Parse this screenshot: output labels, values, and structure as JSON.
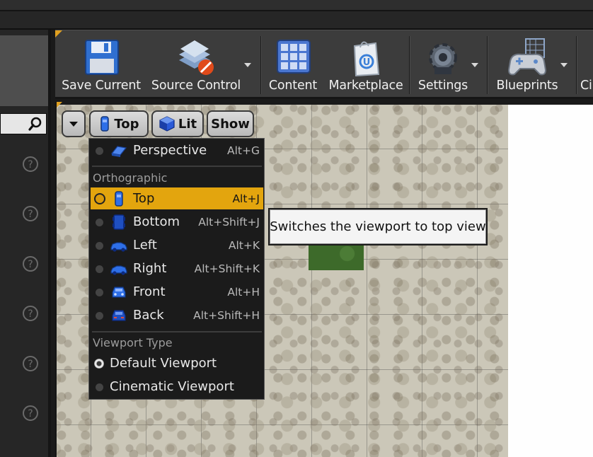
{
  "toolbar": {
    "buttons": [
      {
        "label": "Save Current",
        "icon": "floppy-disk-icon"
      },
      {
        "label": "Source Control",
        "icon": "source-control-icon"
      },
      {
        "label": "Content",
        "icon": "content-grid-icon"
      },
      {
        "label": "Marketplace",
        "icon": "marketplace-bag-icon"
      },
      {
        "label": "Settings",
        "icon": "gear-icon"
      },
      {
        "label": "Blueprints",
        "icon": "gamepad-icon"
      },
      {
        "label": "Ci",
        "icon": "cinematics-icon"
      }
    ]
  },
  "viewport_toolbar": {
    "view_mode": "Top",
    "lighting": "Lit",
    "show": "Show"
  },
  "menu": {
    "perspective": {
      "label": "Perspective",
      "shortcut": "Alt+G"
    },
    "orthographic_heading": "Orthographic",
    "ortho_items": [
      {
        "label": "Top",
        "shortcut": "Alt+J",
        "selected": true
      },
      {
        "label": "Bottom",
        "shortcut": "Alt+Shift+J"
      },
      {
        "label": "Left",
        "shortcut": "Alt+K"
      },
      {
        "label": "Right",
        "shortcut": "Alt+Shift+K"
      },
      {
        "label": "Front",
        "shortcut": "Alt+H"
      },
      {
        "label": "Back",
        "shortcut": "Alt+Shift+H"
      }
    ],
    "viewport_type_heading": "Viewport Type",
    "viewport_types": [
      {
        "label": "Default Viewport",
        "selected": true
      },
      {
        "label": "Cinematic Viewport"
      }
    ]
  },
  "tooltip": {
    "text": "Switches the viewport to top view"
  },
  "colors": {
    "accent": "#e3a50e",
    "menu_bg": "#1b1b1b",
    "toolbar_bg": "#3c3c3c"
  }
}
